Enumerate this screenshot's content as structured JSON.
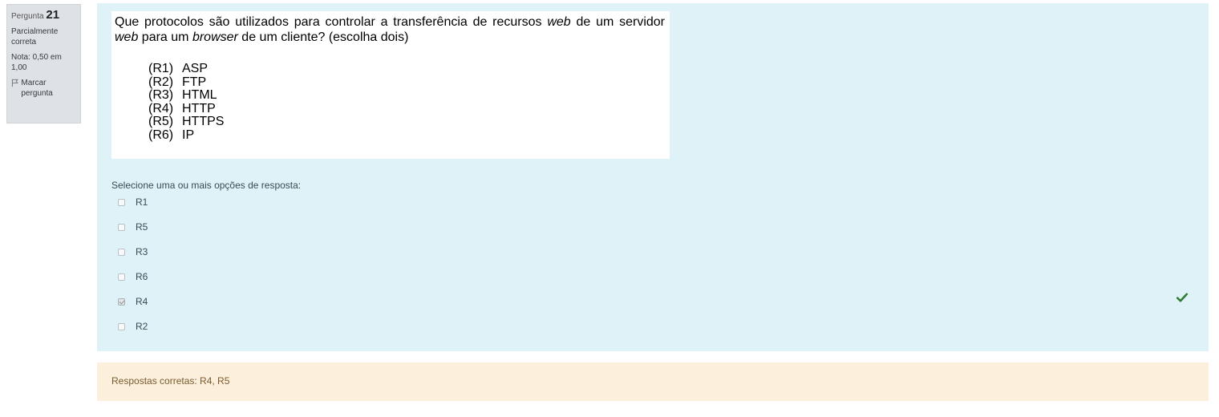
{
  "info": {
    "question_label": "Pergunta",
    "question_number": "21",
    "state": "Parcialmente correta",
    "grade": "Nota: 0,50 em 1,00",
    "flag_label": "Marcar pergunta"
  },
  "question": {
    "stem_part1": "Que protocolos são utilizados para controlar a transferência de recursos ",
    "stem_em1": "web",
    "stem_part2": " de um servidor ",
    "stem_em2": "web",
    "stem_part3": " para um ",
    "stem_em3": "browser",
    "stem_part4": " de um cliente? (escolha dois)",
    "options": [
      {
        "code": "(R1)",
        "text": "ASP"
      },
      {
        "code": "(R2)",
        "text": "FTP"
      },
      {
        "code": "(R3)",
        "text": "HTML"
      },
      {
        "code": "(R4)",
        "text": "HTTP"
      },
      {
        "code": "(R5)",
        "text": "HTTPS"
      },
      {
        "code": "(R6)",
        "text": "IP"
      }
    ]
  },
  "answer": {
    "prompt": "Selecione uma ou mais opções de resposta:",
    "choices": [
      {
        "label": "R1",
        "checked": false
      },
      {
        "label": "R5",
        "checked": false
      },
      {
        "label": "R3",
        "checked": false
      },
      {
        "label": "R6",
        "checked": false
      },
      {
        "label": "R4",
        "checked": true
      },
      {
        "label": "R2",
        "checked": false
      }
    ]
  },
  "feedback": {
    "right_answer": "Respostas corretas: R4, R5",
    "correct_icon": "check-icon",
    "correct_color": "#2e7d32"
  },
  "colors": {
    "formulation_bg": "#def2f8",
    "outcome_bg": "#fcefdc",
    "info_bg": "#dee2e6"
  }
}
